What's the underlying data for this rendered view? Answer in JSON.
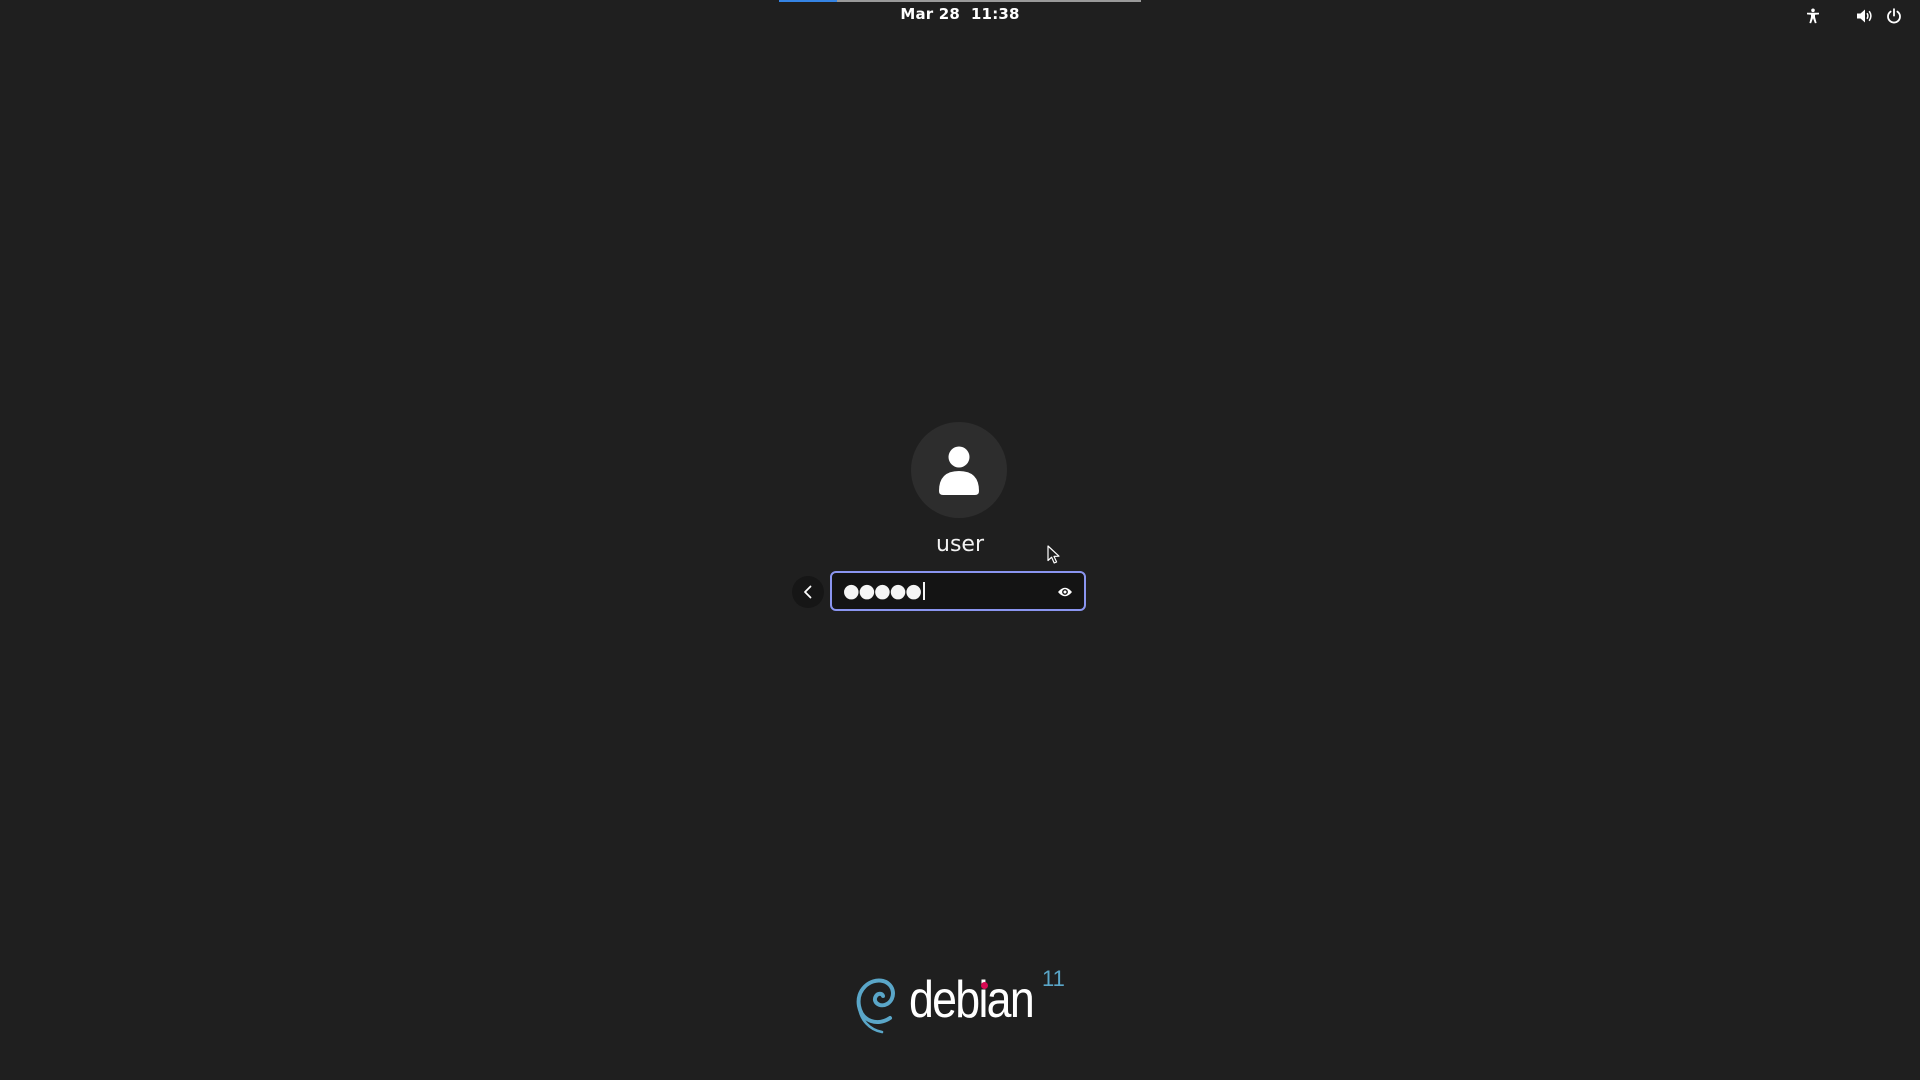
{
  "top_bar": {
    "date": "Mar 28",
    "time": "11:38",
    "progress": 0.16,
    "icons": [
      "accessibility-icon",
      "volume-icon",
      "power-icon"
    ]
  },
  "login": {
    "avatar_icon": "user-avatar-icon",
    "username": "user",
    "password_masked": "●●●●●",
    "back_icon": "chevron-left-icon",
    "reveal_icon": "eye-icon",
    "focus_color": "#8a95f0"
  },
  "branding": {
    "logo_text": "debian",
    "version": "11",
    "swirl_color": "#5aa6c8",
    "dot_color": "#d70a53"
  },
  "colors": {
    "background": "#1f1f1f",
    "accent": "#3584e4"
  }
}
